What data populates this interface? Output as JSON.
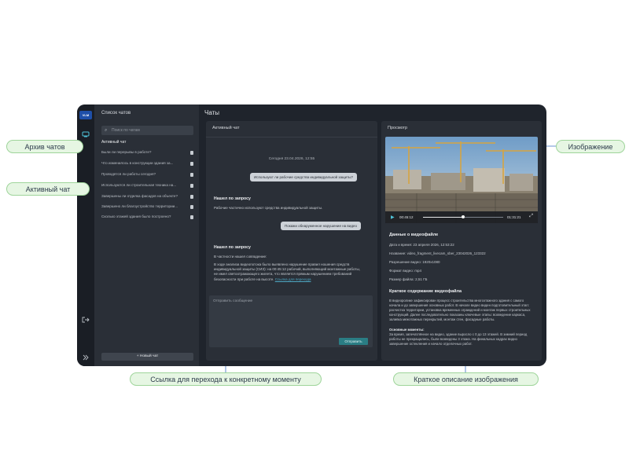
{
  "app": {
    "logo": "VLM",
    "title": "Чаты"
  },
  "sidebar": {
    "title": "Список чатов",
    "search_placeholder": "Поиск по чатам",
    "active_label": "Активный чат",
    "items": [
      {
        "label": "Были ли перерывы в работе?"
      },
      {
        "label": "Что изменилось в конструкции здания за..."
      },
      {
        "label": "Проводятся ли работы сегодня?"
      },
      {
        "label": "Используются ли строительная техника на..."
      },
      {
        "label": "Завершены ли отделка фасадов на объекте?"
      },
      {
        "label": "Завершено ли благоустройство территории..."
      },
      {
        "label": "Сколько этажей здания было построено?"
      }
    ],
    "new_chat_label": "Новый чат"
  },
  "chat": {
    "title": "Активный чат",
    "date": "Сегодня 23.04.2026, 12:55",
    "q1": "Используют ли рабочие средства индивидуальной защиты?",
    "a1_title": "Нашел по запросу",
    "a1_text": "Рабочие частично используют средства индивидуальной защиты.",
    "q2": "Покажи обнаруженное нарушение на видео",
    "a2_title": "Нашел по запросу",
    "a2_intro": "В частности нашел совпадение:",
    "a2_text": "В ходе анализа видеопотока было выявлено нарушение правил ношения средств индивидуальной защиты (СИЗ): на 00:45:12 рабочий, выполняющий монтажные работы, не имел светоотражающего жилета, что является прямым нарушением требований безопасности при работе на высоте.",
    "a2_link": "Ссылка для перехода",
    "input_placeholder": "Отправить сообщение",
    "send_label": "Отправить"
  },
  "viewer": {
    "title": "Просмотр",
    "time_current": "00:45:12",
    "time_total": "01:31:21",
    "progress": 0.5,
    "meta_title": "Данные о видеофайле",
    "meta": [
      "Дата и время: 23 апреля 2026, 12:53:22",
      "Название: video_fragment_livecam_sber_23042026_123322",
      "Разрешение видео: 1920x1080",
      "Формат видео: mp4",
      "Размер файла: 2,51 ГБ"
    ],
    "summary_title": "Краткое содержание видеофайла",
    "summary_text": "В видеоролике зафиксирован процесс строительства многоэтажного здания с самого начала и до завершения основных работ. В начале видео виден подготовительный этап: расчистка территории, установка временных ограждений и монтаж первых строительных конструкций. Далее последовательно показаны ключевые этапы: возведение каркаса, заливка межэтажных перекрытий, монтаж стен, фасадные работы.",
    "key_title": "Основные моменты:",
    "key_text": "За время, запечатлённое на видео, здание выросло с 0 до 13 этажей. В зимний период работы не прекращались, были возведены 3 этажа. На финальных кадрах видно завершение остекления и начало отделочных работ."
  },
  "callouts": {
    "archive": "Архив чатов",
    "active": "Активный чат",
    "image": "Изображение",
    "link": "Ссылка для перехода к конкретному моменту",
    "description": "Краткое описание изображения"
  },
  "colors": {
    "window_bg": "#1f242c",
    "panel_bg": "#2a2f37",
    "accent": "#2a7d84",
    "callout_bg": "#e6f6e3",
    "guide_line": "#3b6fc0"
  }
}
